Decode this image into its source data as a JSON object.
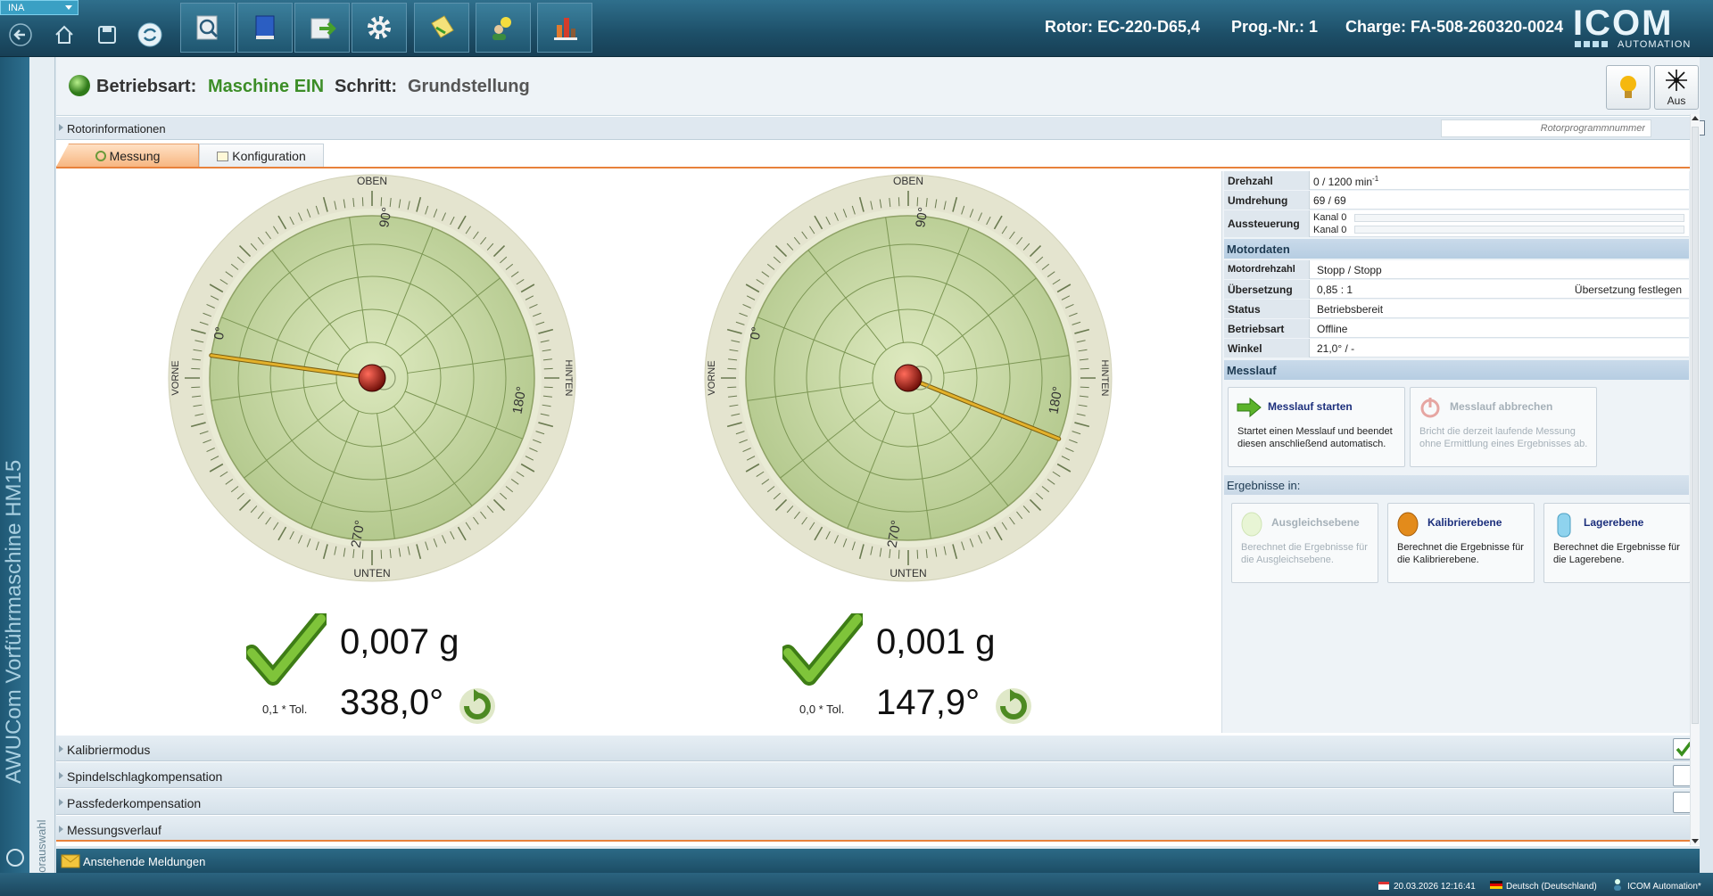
{
  "app": {
    "profile": "INA",
    "vertical_title": "AWUCom Vorführmaschine HM15",
    "rotor_selection_label": "Rotorauswahl"
  },
  "header": {
    "rotor": "Rotor:  EC-220-D65,4",
    "prog": "Prog.-Nr.:  1",
    "charge": "Charge:  FA-508-260320-0024",
    "logo_text": "ICOM",
    "logo_sub": "AUTOMATION"
  },
  "toolbar": {
    "icons": [
      "back-icon",
      "home-icon",
      "save-icon",
      "refresh-icon",
      "search-doc-icon",
      "book-icon",
      "export-icon",
      "settings-icon",
      "notes-icon",
      "user-idea-icon",
      "chart-icon"
    ]
  },
  "status": {
    "mode_label": "Betriebsart:",
    "mode_value": "Maschine EIN",
    "step_label": "Schritt:",
    "step_value": "Grundstellung",
    "laser_label": "Aus"
  },
  "rotorinfo": {
    "label": "Rotorinformationen",
    "placeholder": "Rotorprogrammnummer"
  },
  "tabs": [
    {
      "label": "Messung",
      "active": true
    },
    {
      "label": "Konfiguration",
      "active": false
    }
  ],
  "gauge_labels": {
    "top": "OBEN",
    "bottom": "UNTEN",
    "left": "VORNE",
    "right": "HINTEN",
    "d0": "0°",
    "d90": "90°",
    "d180": "180°",
    "d270": "270°"
  },
  "planes": [
    {
      "mass": "0,007 g",
      "angle": "338,0°",
      "tol": "0,1 * Tol.",
      "needle_deg": 188
    },
    {
      "mass": "0,001 g",
      "angle": "147,9°",
      "tol": "0,0 * Tol.",
      "needle_deg": 22
    }
  ],
  "info": {
    "drehzahl_k": "Drehzahl",
    "drehzahl_v": "0   /   1200   min",
    "drehzahl_sup": "-1",
    "umdrehung_k": "Umdrehung",
    "umdrehung_v": "69   /   69",
    "aussteuerung_k": "Aussteuerung",
    "kanal1": "Kanal 0",
    "kanal2": "Kanal 0",
    "motordaten": "Motordaten",
    "motordrehzahl_k": "Motordrehzahl",
    "motordrehzahl_v": "Stopp   /   Stopp",
    "uebersetzung_k": "Übersetzung",
    "uebersetzung_v": "0,85 : 1",
    "uebersetzung_btn": "Übersetzung festlegen",
    "status_k": "Status",
    "status_v": "Betriebsbereit",
    "betriebsart_k": "Betriebsart",
    "betriebsart_v": "Offline",
    "winkel_k": "Winkel",
    "winkel_v": "21,0°   /   -",
    "messlauf": "Messlauf",
    "ergebnisse": "Ergebnisse in:"
  },
  "cards": {
    "start_title": "Messlauf starten",
    "start_desc": "Startet einen Messlauf und beendet diesen anschließend automatisch.",
    "abort_title": "Messlauf abbrechen",
    "abort_desc": "Bricht die derzeit laufende Messung ohne Ermittlung eines Ergebnisses ab.",
    "ausgleich_title": "Ausgleichsebene",
    "ausgleich_desc": "Berechnet die Ergebnisse für die Ausgleichsebene.",
    "kalibrier_title": "Kalibrierebene",
    "kalibrier_desc": "Berechnet die Ergebnisse für die Kalibrierebene.",
    "lager_title": "Lagerebene",
    "lager_desc": "Berechnet die Ergebnisse für die Lagerebene."
  },
  "accordion": [
    {
      "label": "Kalibriermodus",
      "checked": true
    },
    {
      "label": "Spindelschlagkompensation",
      "checked": false
    },
    {
      "label": "Passfederkompensation",
      "checked": false
    },
    {
      "label": "Messungsverlauf",
      "checked": null
    }
  ],
  "messages": {
    "label": "Anstehende Meldungen"
  },
  "statusbar": {
    "datetime": "20.03.2026 12:16:41",
    "language": "Deutsch (Deutschland)",
    "company": "ICOM Automation*"
  },
  "colors": {
    "accent": "#e8813b",
    "ok_green": "#5e9a1f",
    "dial_face": "#c8d9a6",
    "header": "#1d4f68"
  }
}
